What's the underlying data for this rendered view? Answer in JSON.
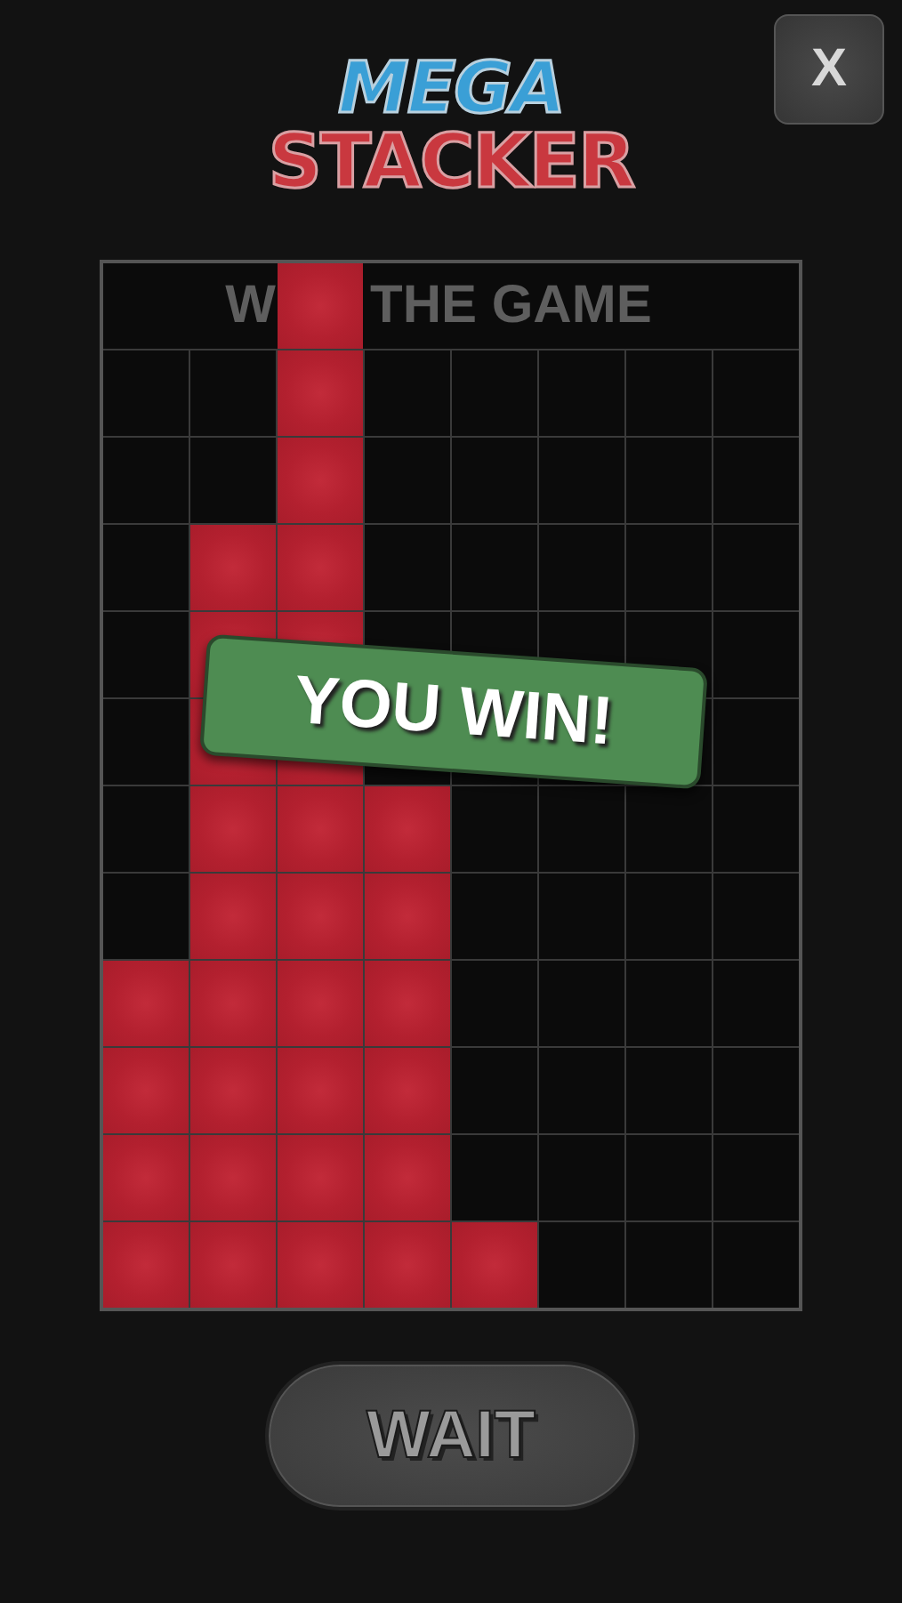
{
  "close_button": {
    "label": "X"
  },
  "logo": {
    "line_1": "MEGA",
    "line_2": "STACKER"
  },
  "board": {
    "header": {
      "left_text": "W",
      "right_text": "THE GAME",
      "block_on_title": true
    },
    "rows": [
      [
        false,
        false,
        true,
        false,
        false,
        false,
        false,
        false
      ],
      [
        false,
        false,
        true,
        false,
        false,
        false,
        false,
        false
      ],
      [
        false,
        true,
        true,
        false,
        false,
        false,
        false,
        false
      ],
      [
        false,
        true,
        true,
        false,
        false,
        false,
        false,
        false
      ],
      [
        false,
        true,
        true,
        false,
        false,
        false,
        false,
        false
      ],
      [
        false,
        true,
        true,
        true,
        false,
        false,
        false,
        false
      ],
      [
        false,
        true,
        true,
        true,
        false,
        false,
        false,
        false
      ],
      [
        true,
        true,
        true,
        true,
        false,
        false,
        false,
        false
      ],
      [
        true,
        true,
        true,
        true,
        false,
        false,
        false,
        false
      ],
      [
        true,
        true,
        true,
        true,
        false,
        false,
        false,
        false
      ],
      [
        true,
        true,
        true,
        true,
        true,
        false,
        false,
        false
      ]
    ]
  },
  "banner": {
    "text": "YOU WIN!"
  },
  "action_button": {
    "label": "WAIT"
  }
}
